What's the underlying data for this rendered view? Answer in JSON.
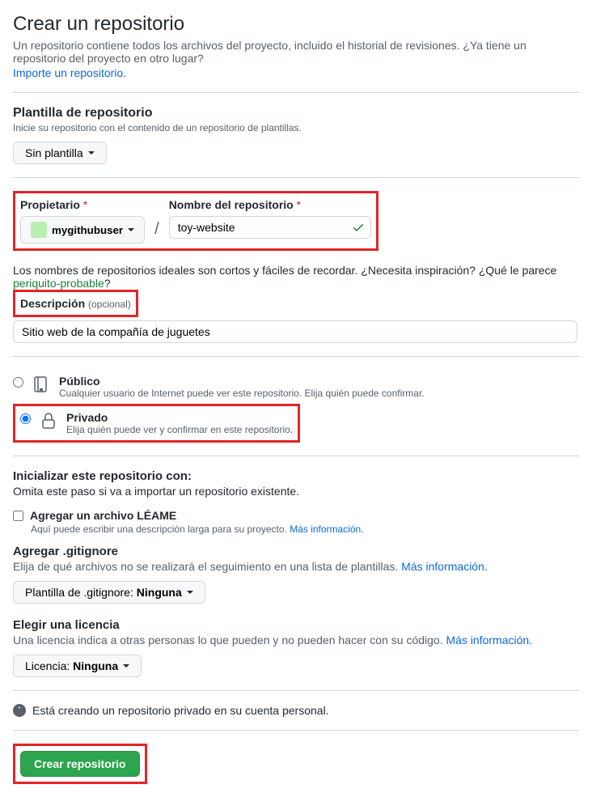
{
  "header": {
    "title": "Crear un repositorio",
    "subtitle": "Un repositorio contiene todos los archivos del proyecto, incluido el historial de revisiones. ¿Ya tiene un repositorio del proyecto en otro lugar?",
    "import_link": "Importe un repositorio."
  },
  "template": {
    "title": "Plantilla de repositorio",
    "desc": "Inicie su repositorio con el contenido de un repositorio de plantillas.",
    "button": "Sin plantilla"
  },
  "owner": {
    "label": "Propietario",
    "value": "mygithubuser"
  },
  "repo_name": {
    "label": "Nombre del repositorio",
    "value": "toy-website"
  },
  "name_hint": {
    "pre": "Los nombres de repositorios ideales son cortos y fáciles de recordar. ¿Necesita inspiración? ¿Qué le parece ",
    "suggestion": "periquito-probable",
    "post": "?"
  },
  "description": {
    "label": "Descripción",
    "optional": "(opcional)",
    "value": "Sitio web de la compañía de juguetes"
  },
  "visibility": {
    "public": {
      "label": "Público",
      "desc": "Cualquier usuario de Internet puede ver este repositorio. Elija quién puede confirmar."
    },
    "private": {
      "label": "Privado",
      "desc": "Elija quién puede ver y confirmar en este repositorio."
    },
    "selected": "private"
  },
  "initialize": {
    "title": "Inicializar este repositorio con:",
    "desc": "Omita este paso si va a importar un repositorio existente.",
    "readme": {
      "label": "Agregar un archivo LÉAME",
      "desc": "Aquí puede escribir una descripción larga para su proyecto.",
      "more": "Más información."
    }
  },
  "gitignore": {
    "title": "Agregar .gitignore",
    "desc": "Elija de qué archivos no se realizará el seguimiento en una lista de plantillas.",
    "more": "Más información.",
    "button_prefix": "Plantilla de .gitignore: ",
    "button_value": "Ninguna"
  },
  "license": {
    "title": "Elegir una licencia",
    "desc": "Una licencia indica a otras personas lo que pueden y no pueden hacer con su código.",
    "more": "Más información.",
    "button_prefix": "Licencia: ",
    "button_value": "Ninguna"
  },
  "info_banner": "Está creando un repositorio privado en su cuenta personal.",
  "submit": "Crear repositorio"
}
